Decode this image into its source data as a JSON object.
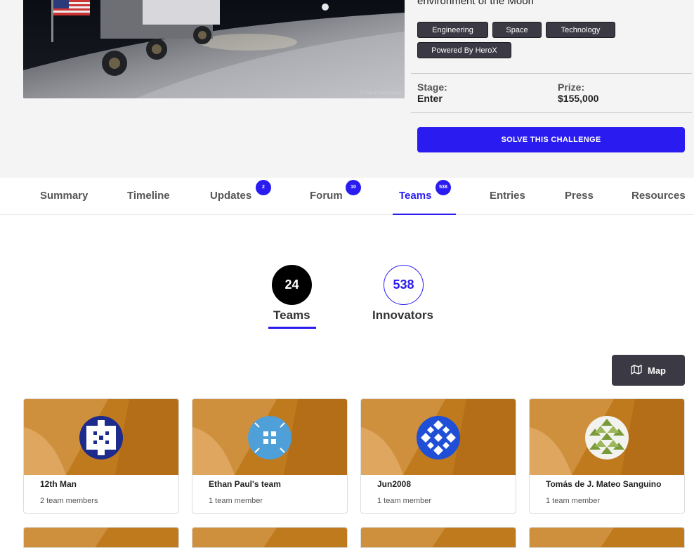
{
  "hero": {
    "credit": "© Felix & Paul Studios",
    "subtitle": "environment of the Moon"
  },
  "tags": [
    "Engineering",
    "Space",
    "Technology",
    "Powered By HeroX"
  ],
  "stats": {
    "stage_label": "Stage:",
    "stage_value": "Enter",
    "prize_label": "Prize:",
    "prize_value": "$155,000"
  },
  "solve_button": "SOLVE THIS CHALLENGE",
  "tabs": [
    {
      "label": "Summary"
    },
    {
      "label": "Timeline"
    },
    {
      "label": "Updates",
      "badge": "2"
    },
    {
      "label": "Forum",
      "badge": "10"
    },
    {
      "label": "Teams",
      "badge": "538",
      "active": true
    },
    {
      "label": "Entries"
    },
    {
      "label": "Press"
    },
    {
      "label": "Resources"
    }
  ],
  "counts": {
    "teams_value": "24",
    "teams_label": "Teams",
    "innovators_value": "538",
    "innovators_label": "Innovators"
  },
  "map_button": "Map",
  "teams": [
    {
      "name": "12th Man",
      "members": "2 team members"
    },
    {
      "name": "Ethan Paul's team",
      "members": "1 team member"
    },
    {
      "name": "Jun2008",
      "members": "1 team member"
    },
    {
      "name": "Tomás de J. Mateo Sanguino",
      "members": "1 team member"
    }
  ],
  "colors": {
    "accent": "#2a1cf0",
    "dark": "#3a3944",
    "tag_bg": "#3a3944"
  }
}
